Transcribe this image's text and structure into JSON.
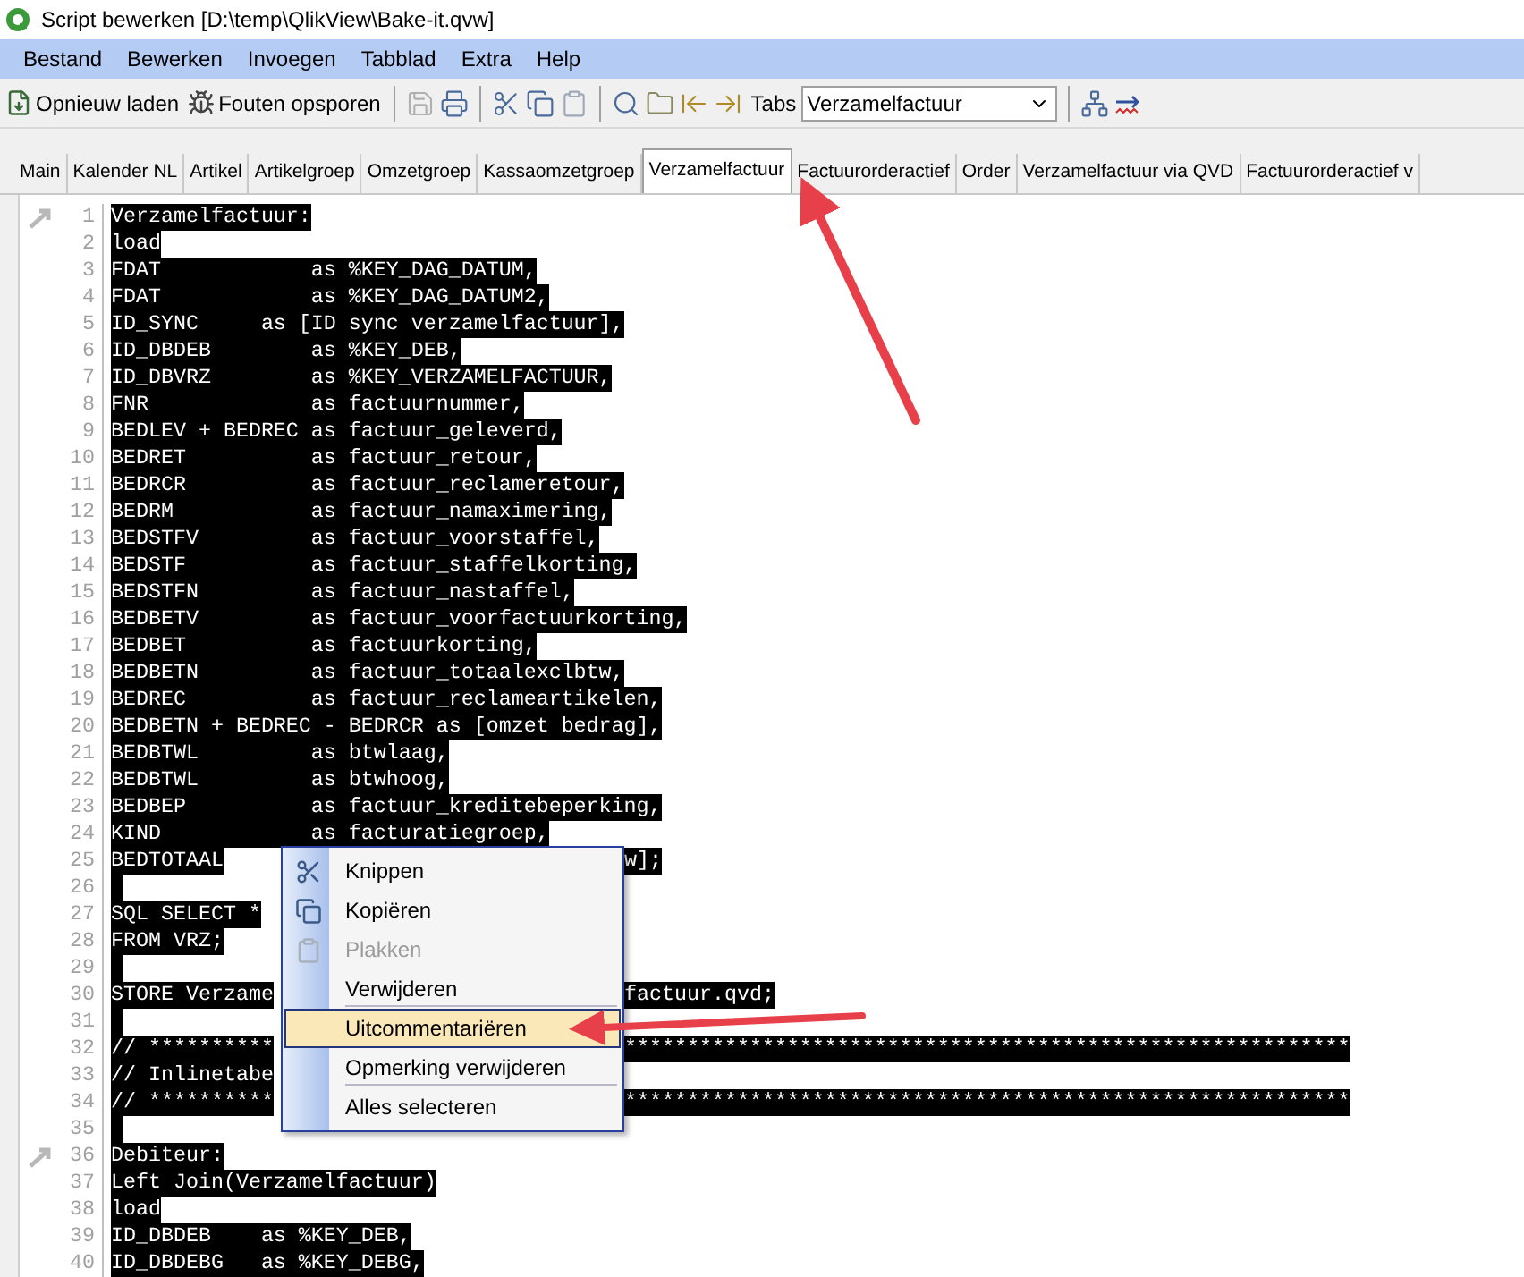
{
  "window": {
    "title": "Script bewerken [D:\\temp\\QlikView\\Bake-it.qvw]"
  },
  "menu_bar": [
    "Bestand",
    "Bewerken",
    "Invoegen",
    "Tabblad",
    "Extra",
    "Help"
  ],
  "toolbar": {
    "reload_label": "Opnieuw laden",
    "debug_label": "Fouten opsporen",
    "tabs_label": "Tabs",
    "tabs_dropdown": "Verzamelfactuur"
  },
  "tabs": [
    {
      "label": "Main",
      "selected": false
    },
    {
      "label": "Kalender NL",
      "selected": false
    },
    {
      "label": "Artikel",
      "selected": false
    },
    {
      "label": "Artikelgroep",
      "selected": false
    },
    {
      "label": "Omzetgroep",
      "selected": false
    },
    {
      "label": "Kassaomzetgroep",
      "selected": false
    },
    {
      "label": "Verzamelfactuur",
      "selected": true
    },
    {
      "label": "Factuurorderactief",
      "selected": false
    },
    {
      "label": "Order",
      "selected": false
    },
    {
      "label": "Verzamelfactuur via QVD",
      "selected": false
    },
    {
      "label": "Factuurorderactief v",
      "selected": false
    }
  ],
  "editor": {
    "selected": true,
    "lines": [
      {
        "number": "1",
        "text": "Verzamelfactuur:",
        "bookmark": true
      },
      {
        "number": "2",
        "text": "load",
        "bookmark": false
      },
      {
        "number": "3",
        "text": "FDAT            as %KEY_DAG_DATUM,",
        "bookmark": false
      },
      {
        "number": "4",
        "text": "FDAT            as %KEY_DAG_DATUM2,",
        "bookmark": false
      },
      {
        "number": "5",
        "text": "ID_SYNC     as [ID sync verzamelfactuur],",
        "bookmark": false
      },
      {
        "number": "6",
        "text": "ID_DBDEB        as %KEY_DEB,",
        "bookmark": false
      },
      {
        "number": "7",
        "text": "ID_DBVRZ        as %KEY_VERZAMELFACTUUR,",
        "bookmark": false
      },
      {
        "number": "8",
        "text": "FNR             as factuurnummer,",
        "bookmark": false
      },
      {
        "number": "9",
        "text": "BEDLEV + BEDREC as factuur_geleverd,",
        "bookmark": false
      },
      {
        "number": "10",
        "text": "BEDRET          as factuur_retour,",
        "bookmark": false
      },
      {
        "number": "11",
        "text": "BEDRCR          as factuur_reclameretour,",
        "bookmark": false
      },
      {
        "number": "12",
        "text": "BEDRM           as factuur_namaximering,",
        "bookmark": false
      },
      {
        "number": "13",
        "text": "BEDSTFV         as factuur_voorstaffel,",
        "bookmark": false
      },
      {
        "number": "14",
        "text": "BEDSTF          as factuur_staffelkorting,",
        "bookmark": false
      },
      {
        "number": "15",
        "text": "BEDSTFN         as factuur_nastaffel,",
        "bookmark": false
      },
      {
        "number": "16",
        "text": "BEDBETV         as factuur_voorfactuurkorting,",
        "bookmark": false
      },
      {
        "number": "17",
        "text": "BEDBET          as factuurkorting,",
        "bookmark": false
      },
      {
        "number": "18",
        "text": "BEDBETN         as factuur_totaalexclbtw,",
        "bookmark": false
      },
      {
        "number": "19",
        "text": "BEDREC          as factuur_reclameartikelen,",
        "bookmark": false
      },
      {
        "number": "20",
        "text": "BEDBETN + BEDREC - BEDRCR as [omzet bedrag],",
        "bookmark": false
      },
      {
        "number": "21",
        "text": "BEDBTWL         as btwlaag,",
        "bookmark": false
      },
      {
        "number": "22",
        "text": "BEDBTWL         as btwhoog,",
        "bookmark": false
      },
      {
        "number": "23",
        "text": "BEDBEP          as factuur_kreditebeperking,",
        "bookmark": false
      },
      {
        "number": "24",
        "text": "KIND            as facturatiegroep,",
        "bookmark": false
      },
      {
        "number": "25",
        "text": "BEDTOTAAL",
        "tail": "w];",
        "bookmark": false
      },
      {
        "number": "26",
        "bookmark": false
      },
      {
        "number": "27",
        "text": "SQL SELECT *",
        "bookmark": false
      },
      {
        "number": "28",
        "text": "FROM VRZ;",
        "bookmark": false
      },
      {
        "number": "29",
        "bookmark": false
      },
      {
        "number": "30",
        "text": "STORE Verzame",
        "tail": "factuur.qvd;",
        "bookmark": false
      },
      {
        "number": "31",
        "bookmark": false
      },
      {
        "number": "32",
        "text": "// **********",
        "tail": "**********************************************************",
        "bookmark": false
      },
      {
        "number": "33",
        "text": "// Inlinetabe",
        "bookmark": false
      },
      {
        "number": "34",
        "text": "// **********",
        "tail": "**********************************************************",
        "bookmark": false
      },
      {
        "number": "35",
        "bookmark": false
      },
      {
        "number": "36",
        "text": "Debiteur:",
        "bookmark": true
      },
      {
        "number": "37",
        "text": "Left Join(Verzamelfactuur)",
        "bookmark": false
      },
      {
        "number": "38",
        "text": "load",
        "bookmark": false
      },
      {
        "number": "39",
        "text": "ID_DBDEB    as %KEY_DEB,",
        "bookmark": false
      },
      {
        "number": "40",
        "text": "ID_DBDEBG   as %KEY_DEBG,",
        "bookmark": false
      }
    ]
  },
  "context_menu": [
    {
      "label": "Knippen",
      "kind": "cut",
      "disabled": false,
      "selected": false,
      "separator_after": false
    },
    {
      "label": "Kopiëren",
      "kind": "copy",
      "disabled": false,
      "selected": false,
      "separator_after": false
    },
    {
      "label": "Plakken",
      "kind": "paste",
      "disabled": true,
      "selected": false,
      "separator_after": false
    },
    {
      "label": "Verwijderen",
      "kind": "plain",
      "disabled": false,
      "selected": false,
      "separator_after": true
    },
    {
      "label": "Uitcommentariëren",
      "kind": "plain",
      "disabled": false,
      "selected": true,
      "separator_after": false
    },
    {
      "label": "Opmerking verwijderen",
      "kind": "plain",
      "disabled": false,
      "selected": false,
      "separator_after": true
    },
    {
      "label": "Alles selecteren",
      "kind": "plain",
      "disabled": false,
      "selected": false,
      "separator_after": false
    }
  ]
}
